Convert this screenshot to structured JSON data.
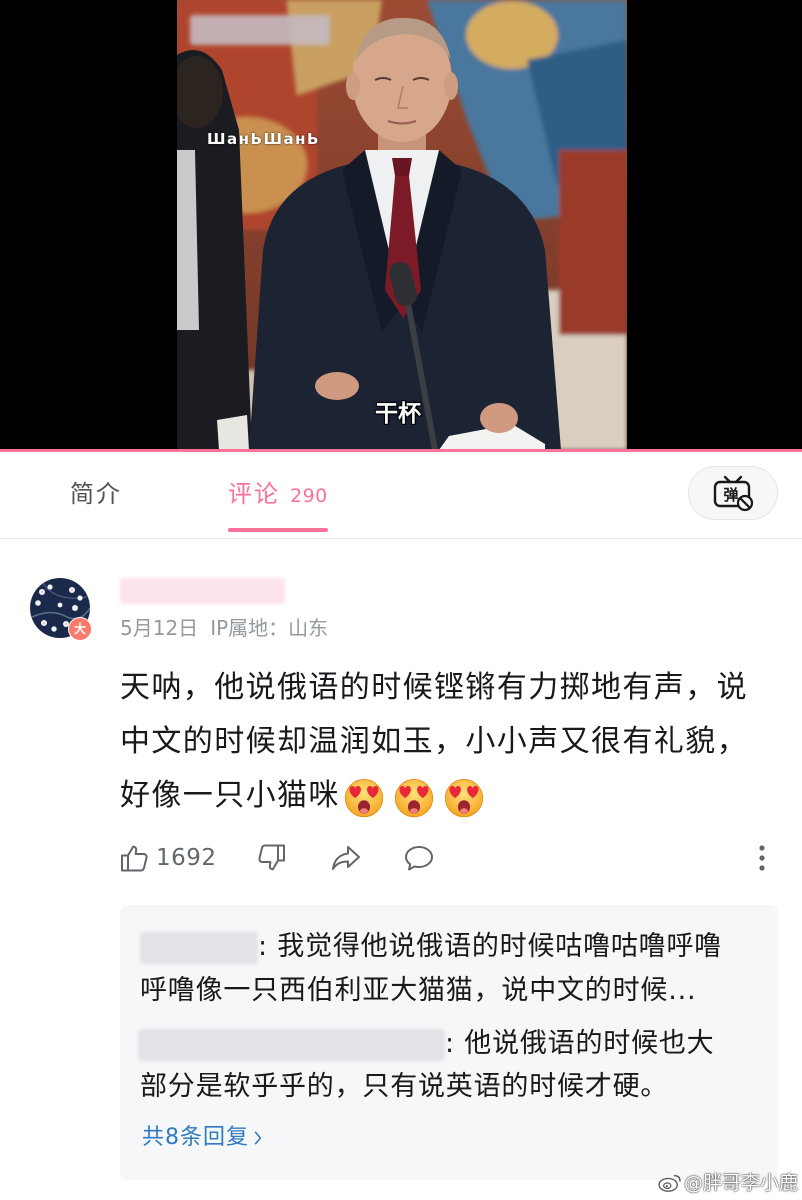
{
  "video": {
    "watermark": "ШанЬШанЬ",
    "subtitle": "干杯"
  },
  "tabs": [
    {
      "label": "简介",
      "active": false
    },
    {
      "label": "评论",
      "count": "290",
      "active": true
    }
  ],
  "danmaku_toggle": {
    "icon": "danmaku-off-icon",
    "glyph": "弹"
  },
  "comment": {
    "avatar_badge": "大",
    "date": "5月12日",
    "ip": "IP属地：山东",
    "lines": [
      "天呐，他说俄语的时候铿锵有力掷地有声，说",
      "中文的时候却温润如玉，小小声又很有礼貌，",
      "好像一只小猫咪"
    ],
    "emojis": [
      "heart-eyes-emoji",
      "heart-eyes-emoji",
      "heart-eyes-emoji"
    ],
    "actions": {
      "like_icon": "thumb-up-icon",
      "likes": "1692",
      "dislike_icon": "thumb-down-icon",
      "share_icon": "share-icon",
      "reply_icon": "comment-bubble-icon",
      "more_icon": "more-vertical-icon"
    },
    "replies": [
      {
        "lines": [
          ": 我觉得他说俄语的时候咕噜咕噜呼噜",
          "呼噜像一只西伯利亚大猫猫，说中文的时候..."
        ]
      },
      {
        "lines": [
          ": 他说俄语的时候也大",
          "部分是软乎乎的，只有说英语的时候才硬。"
        ]
      }
    ],
    "more_replies": "共8条回复"
  },
  "footer_watermark": "@胖哥李小鹿",
  "colors": {
    "accent": "#fb7299",
    "link": "#2f7bc1",
    "meta_text": "#9499a0",
    "body_text": "#18191c",
    "reply_bg": "#f6f7f8"
  }
}
